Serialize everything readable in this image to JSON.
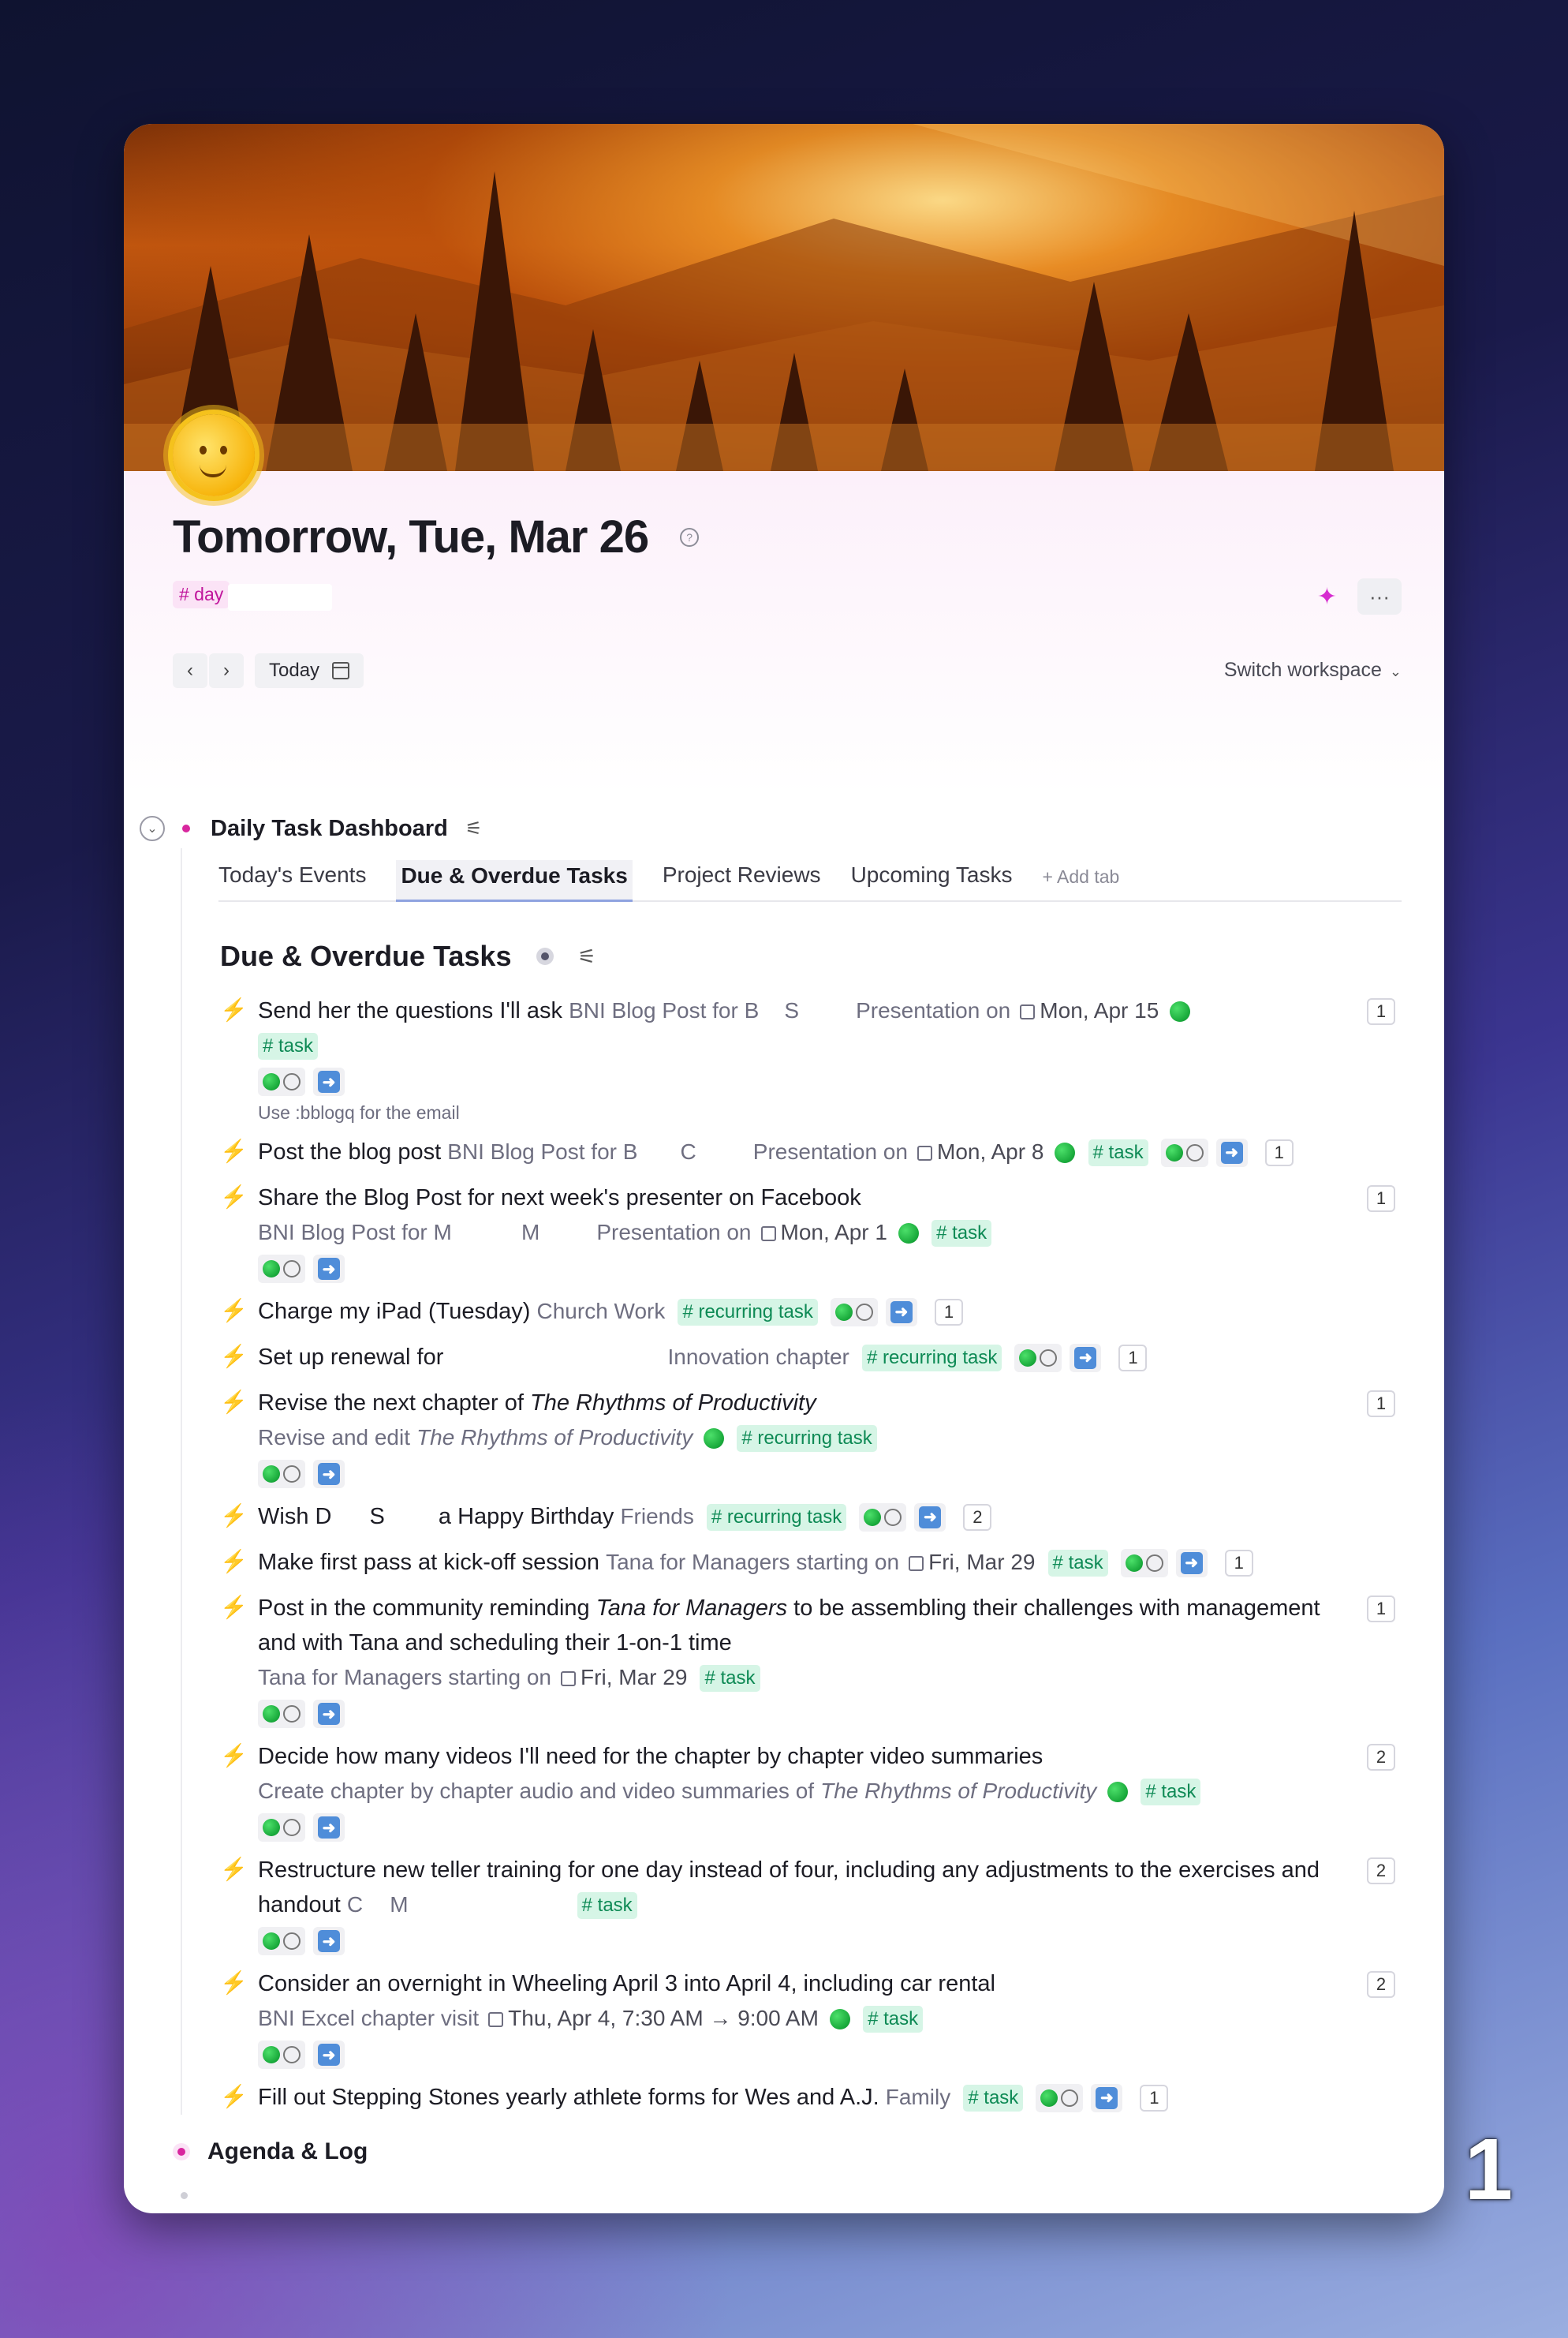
{
  "page": {
    "title": "Tomorrow, Tue, Mar 26",
    "tag": "# day",
    "today_label": "Today",
    "switch_workspace": "Switch workspace",
    "corner_number": "1"
  },
  "dashboard": {
    "title": "Daily Task Dashboard",
    "tabs": [
      "Today's Events",
      "Due & Overdue Tasks",
      "Project Reviews",
      "Upcoming Tasks",
      "+ Add tab"
    ],
    "section_title": "Due & Overdue Tasks"
  },
  "tasks": [
    {
      "title": "Send her the questions I'll ask",
      "ref": "BNI Blog Post for B",
      "ref2": "S",
      "ref3": "Presentation on",
      "date": "Mon, Apr 15",
      "tag": "# task",
      "note": "Use :bblogq for the email",
      "count": "1"
    },
    {
      "title": "Post the blog post",
      "ref": "BNI Blog Post for B",
      "ref2": "C",
      "ref3": "Presentation on",
      "date": "Mon, Apr 8",
      "tag": "# task",
      "count": "1"
    },
    {
      "title": "Share the Blog Post for next week's presenter on Facebook",
      "ref": "BNI Blog Post for M",
      "ref2": "M",
      "ref3": "Presentation on",
      "date": "Mon, Apr 1",
      "tag": "# task",
      "count": "1"
    },
    {
      "title": "Charge my iPad (Tuesday)",
      "ref": "Church Work",
      "tag": "# recurring task",
      "count": "1"
    },
    {
      "title": "Set up renewal for",
      "ref": "Innovation chapter",
      "tag": "# recurring task",
      "count": "1"
    },
    {
      "title_prefix": "Revise the next chapter of",
      "title_em": "The Rhythms of Productivity",
      "ref": "Revise and edit",
      "ref_em": "The Rhythms of Productivity",
      "tag": "# recurring task",
      "count": "1"
    },
    {
      "title_prefix": "Wish D",
      "title_mid": "S",
      "title_suffix": "a Happy Birthday",
      "ref": "Friends",
      "tag": "# recurring task",
      "count": "2"
    },
    {
      "title": "Make first pass at kick-off session",
      "ref": "Tana for Managers starting on",
      "date": "Fri, Mar 29",
      "tag": "# task",
      "count": "1"
    },
    {
      "title_prefix": "Post in the community reminding",
      "title_em": "Tana for Managers",
      "title_suffix": "to be assembling their challenges with management and with Tana and scheduling their 1-on-1 time",
      "ref": "Tana for Managers starting on",
      "date": "Fri, Mar 29",
      "tag": "# task",
      "count": "1"
    },
    {
      "title": "Decide how many videos I'll need for the chapter by chapter video summaries",
      "ref": "Create chapter by chapter audio and video summaries of",
      "ref_em": "The Rhythms of Productivity",
      "tag": "# task",
      "count": "2"
    },
    {
      "title": "Restructure new teller training for one day instead of four, including any adjustments to the exercises and handout",
      "ref": "C",
      "ref2": "M",
      "tag": "# task",
      "count": "2"
    },
    {
      "title": "Consider an overnight in Wheeling April 3 into April 4, including car rental",
      "ref": "BNI Excel chapter visit",
      "date": "Thu, Apr 4, 7:30 AM → 9:00 AM",
      "tag": "# task",
      "count": "2"
    },
    {
      "title": "Fill out Stepping Stones yearly athlete forms for Wes and A.J.",
      "ref": "Family",
      "tag": "# task",
      "count": "1"
    }
  ],
  "agenda": {
    "title": "Agenda & Log"
  },
  "colors": {
    "accent_pink": "#d8279e",
    "tag_green": "#0e8a55",
    "bolt_orange": "#f2a10a"
  }
}
